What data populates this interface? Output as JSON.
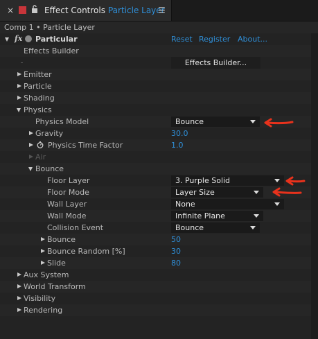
{
  "tab": {
    "title": "Effect Controls",
    "layer": "Particle Layer",
    "close_glyph": "×",
    "menu_glyph": "☰",
    "swatch_color": "#c8353a"
  },
  "comp_path": "Comp 1 • Particle Layer",
  "effect": {
    "fx_label": "fx",
    "name": "Particular",
    "links": {
      "reset": "Reset",
      "register": "Register",
      "about": "About..."
    }
  },
  "effects_builder": {
    "label": "Effects Builder",
    "button": "Effects Builder..."
  },
  "groups": {
    "emitter": "Emitter",
    "particle": "Particle",
    "shading": "Shading",
    "physics": "Physics",
    "aux_system": "Aux System",
    "world_transform": "World Transform",
    "visibility": "Visibility",
    "rendering": "Rendering"
  },
  "physics": {
    "model_label": "Physics Model",
    "model_value": "Bounce",
    "gravity_label": "Gravity",
    "gravity_value": "30.0",
    "time_factor_label": "Physics Time Factor",
    "time_factor_value": "1.0",
    "air_label": "Air",
    "bounce_group_label": "Bounce"
  },
  "bounce": {
    "floor_layer_label": "Floor Layer",
    "floor_layer_value": "3. Purple Solid",
    "floor_mode_label": "Floor Mode",
    "floor_mode_value": "Layer Size",
    "wall_layer_label": "Wall Layer",
    "wall_layer_value": "None",
    "wall_mode_label": "Wall Mode",
    "wall_mode_value": "Infinite Plane",
    "collision_event_label": "Collision Event",
    "collision_event_value": "Bounce",
    "bounce_label": "Bounce",
    "bounce_value": "50",
    "bounce_random_label": "Bounce Random [%]",
    "bounce_random_value": "30",
    "slide_label": "Slide",
    "slide_value": "80"
  },
  "colors": {
    "accent": "#2f8fd8",
    "annotation_arrow": "#e8321c"
  }
}
